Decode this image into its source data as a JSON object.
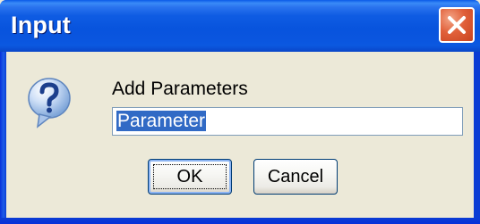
{
  "window": {
    "title": "Input"
  },
  "dialog": {
    "message": "Add Parameters",
    "input_value": "Parameter",
    "icon": "question-icon"
  },
  "buttons": {
    "ok_label": "OK",
    "cancel_label": "Cancel"
  },
  "colors": {
    "titlebar": "#0a55df",
    "client_bg": "#ece9d8",
    "selection": "#316ac5",
    "close_btn": "#e1603a"
  }
}
